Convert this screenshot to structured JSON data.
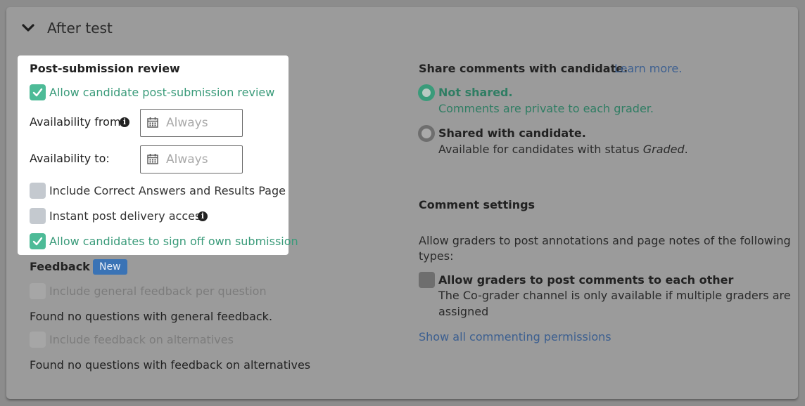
{
  "section": {
    "title": "After test"
  },
  "post_submission": {
    "title": "Post-submission review",
    "allow_review_label": "Allow candidate post-submission review",
    "availability_from_label": "Availability from:",
    "availability_from_placeholder": "Always",
    "availability_to_label": "Availability to:",
    "availability_to_placeholder": "Always",
    "include_correct_label": "Include Correct Answers and Results Page",
    "instant_access_label": "Instant post delivery access",
    "sign_off_label": "Allow candidates to sign off own submission"
  },
  "feedback": {
    "title": "Feedback",
    "badge": "New",
    "general_label": "Include general feedback per question",
    "general_note": "Found no questions with general feedback.",
    "alternatives_label": "Include feedback on alternatives",
    "alternatives_note": "Found no questions with feedback on alternatives"
  },
  "share_comments": {
    "title": "Share comments with candidate.",
    "learn_more": "Learn more.",
    "not_shared_label": "Not shared.",
    "not_shared_desc": "Comments are private to each grader.",
    "shared_label": "Shared with candidate.",
    "shared_desc_prefix": "Available for candidates with status ",
    "shared_desc_status": "Graded",
    "shared_desc_suffix": "."
  },
  "comment_settings": {
    "title": "Comment settings",
    "description_line1": "Allow graders to post annotations and page notes of the following",
    "description_line2": "types:",
    "graders_each_other_label": "Allow graders to post comments to each other",
    "graders_note_line1": "The Co-grader channel is only available if multiple graders are",
    "graders_note_line2": "assigned",
    "show_all_link": "Show all commenting permissions"
  },
  "icons": {
    "chevron": "chevron-down-icon",
    "calendar": "calendar-icon",
    "info": "info-icon",
    "check": "check-icon"
  },
  "colors": {
    "accent_green": "#4dbb97",
    "link_blue": "#3c5f90",
    "badge_blue": "#3a73b5"
  }
}
